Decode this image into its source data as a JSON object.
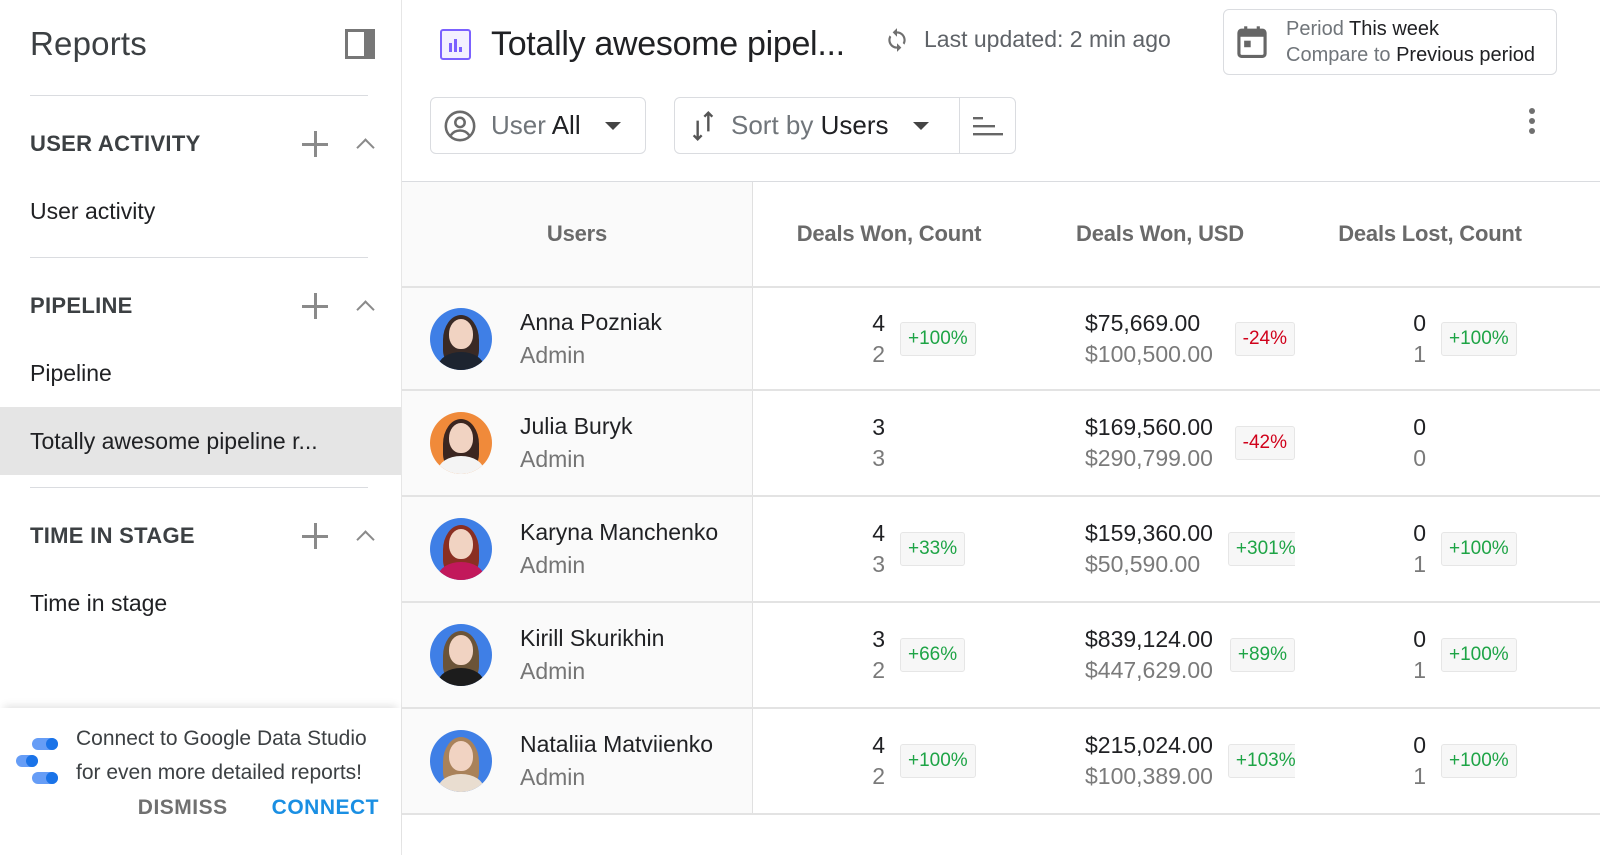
{
  "sidebar": {
    "title": "Reports",
    "sections": [
      {
        "title": "USER ACTIVITY",
        "items": [
          {
            "label": "User activity",
            "active": false
          }
        ]
      },
      {
        "title": "PIPELINE",
        "items": [
          {
            "label": "Pipeline",
            "active": false
          },
          {
            "label": "Totally awesome pipeline r...",
            "active": true
          }
        ]
      },
      {
        "title": "TIME IN STAGE",
        "items": [
          {
            "label": "Time in stage",
            "active": false
          }
        ]
      }
    ],
    "promo": {
      "line1": "Connect to Google Data Studio",
      "line2": "for even more detailed reports!",
      "dismiss_label": "DISMISS",
      "connect_label": "CONNECT"
    }
  },
  "header": {
    "title": "Totally awesome pipel...",
    "last_updated": "Last updated: 2 min ago",
    "period": {
      "period_label": "Period",
      "period_value": "This week",
      "compare_label": "Compare to",
      "compare_value": "Previous period"
    }
  },
  "filters": {
    "user": {
      "label": "User",
      "value": "All"
    },
    "sort": {
      "label": "Sort by",
      "value": "Users"
    }
  },
  "table": {
    "columns": [
      "Users",
      "Deals Won, Count",
      "Deals Won, USD",
      "Deals Lost, Count"
    ],
    "rows": [
      {
        "name": "Anna Pozniak",
        "role": "Admin",
        "won_count": {
          "current": "4",
          "previous": "2",
          "change": "+100%",
          "trend": "pos"
        },
        "won_usd": {
          "current": "$75,669.00",
          "previous": "$100,500.00",
          "change": "-24%",
          "trend": "neg"
        },
        "lost_count": {
          "current": "0",
          "previous": "1",
          "change": "+100%",
          "trend": "pos"
        }
      },
      {
        "name": "Julia Buryk",
        "role": "Admin",
        "won_count": {
          "current": "3",
          "previous": "3",
          "change": "",
          "trend": ""
        },
        "won_usd": {
          "current": "$169,560.00",
          "previous": "$290,799.00",
          "change": "-42%",
          "trend": "neg"
        },
        "lost_count": {
          "current": "0",
          "previous": "0",
          "change": "",
          "trend": ""
        }
      },
      {
        "name": "Karyna Manchenko",
        "role": "Admin",
        "won_count": {
          "current": "4",
          "previous": "3",
          "change": "+33%",
          "trend": "pos"
        },
        "won_usd": {
          "current": "$159,360.00",
          "previous": "$50,590.00",
          "change": "+301%",
          "trend": "pos"
        },
        "lost_count": {
          "current": "0",
          "previous": "1",
          "change": "+100%",
          "trend": "pos"
        }
      },
      {
        "name": "Kirill Skurikhin",
        "role": "Admin",
        "won_count": {
          "current": "3",
          "previous": "2",
          "change": "+66%",
          "trend": "pos"
        },
        "won_usd": {
          "current": "$839,124.00",
          "previous": "$447,629.00",
          "change": "+89%",
          "trend": "pos"
        },
        "lost_count": {
          "current": "0",
          "previous": "1",
          "change": "+100%",
          "trend": "pos"
        }
      },
      {
        "name": "Nataliia Matviienko",
        "role": "Admin",
        "won_count": {
          "current": "4",
          "previous": "2",
          "change": "+100%",
          "trend": "pos"
        },
        "won_usd": {
          "current": "$215,024.00",
          "previous": "$100,389.00",
          "change": "+103%",
          "trend": "pos"
        },
        "lost_count": {
          "current": "0",
          "previous": "1",
          "change": "+100%",
          "trend": "pos"
        }
      }
    ]
  },
  "colors": {
    "accent_purple": "#7b61ff",
    "positive": "#1ea446",
    "negative": "#d0021b",
    "link_blue": "#1a8fe3",
    "active_item_bg": "#e5e5e5"
  },
  "icons": {
    "panel": "panel-toggle-icon",
    "add": "plus-icon",
    "collapse": "chevron-up-icon",
    "report": "bar-chart-icon",
    "sync": "sync-icon",
    "calendar": "calendar-icon",
    "user": "account-circle-icon",
    "sort": "sort-arrows-icon",
    "dropdown": "caret-down-icon",
    "order": "sort-order-icon",
    "more": "more-vertical-icon",
    "gds": "google-data-studio-icon"
  }
}
